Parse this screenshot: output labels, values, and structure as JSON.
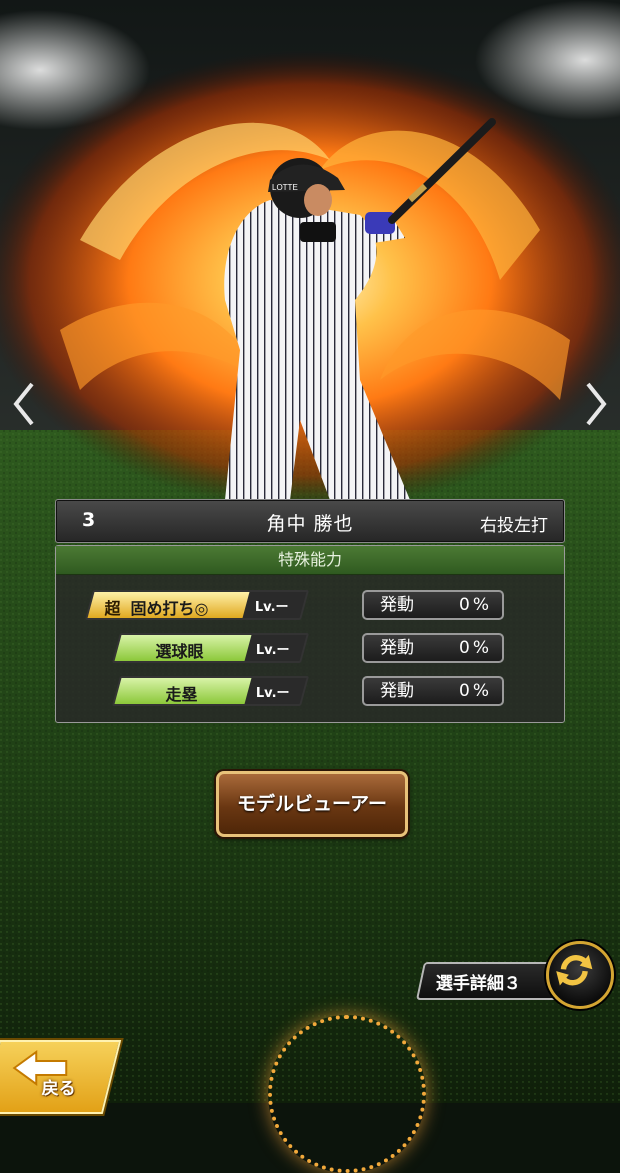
{
  "player": {
    "number": "3",
    "name": "角中 勝也",
    "hand": "右投左打",
    "helmet_text": "LOTTE"
  },
  "abilities": {
    "header": "特殊能力",
    "items": [
      {
        "super_mark": "超",
        "name": "固め打ち◎",
        "level": "Lv.ー",
        "trigger_label": "発動",
        "trigger_value": "0%",
        "color": "#f0c040"
      },
      {
        "super_mark": "",
        "name": "選球眼",
        "level": "Lv.ー",
        "trigger_label": "発動",
        "trigger_value": "0%",
        "color": "#9ad64a"
      },
      {
        "super_mark": "",
        "name": "走塁",
        "level": "Lv.ー",
        "trigger_label": "発動",
        "trigger_value": "0%",
        "color": "#9ad64a"
      }
    ]
  },
  "buttons": {
    "model_viewer": "モデルビューアー",
    "player_detail": "選手詳細３",
    "back": "戻る"
  },
  "icons": {
    "prev": "chevron-left-icon",
    "next": "chevron-right-icon",
    "cycle": "cycle-arrows-icon",
    "back_arrow": "back-arrow-icon"
  },
  "colors": {
    "accent_gold": "#e8c27a",
    "ability_green": "#9ad64a",
    "super_gold": "#f0c040",
    "header_green": "#3f6b2a"
  }
}
